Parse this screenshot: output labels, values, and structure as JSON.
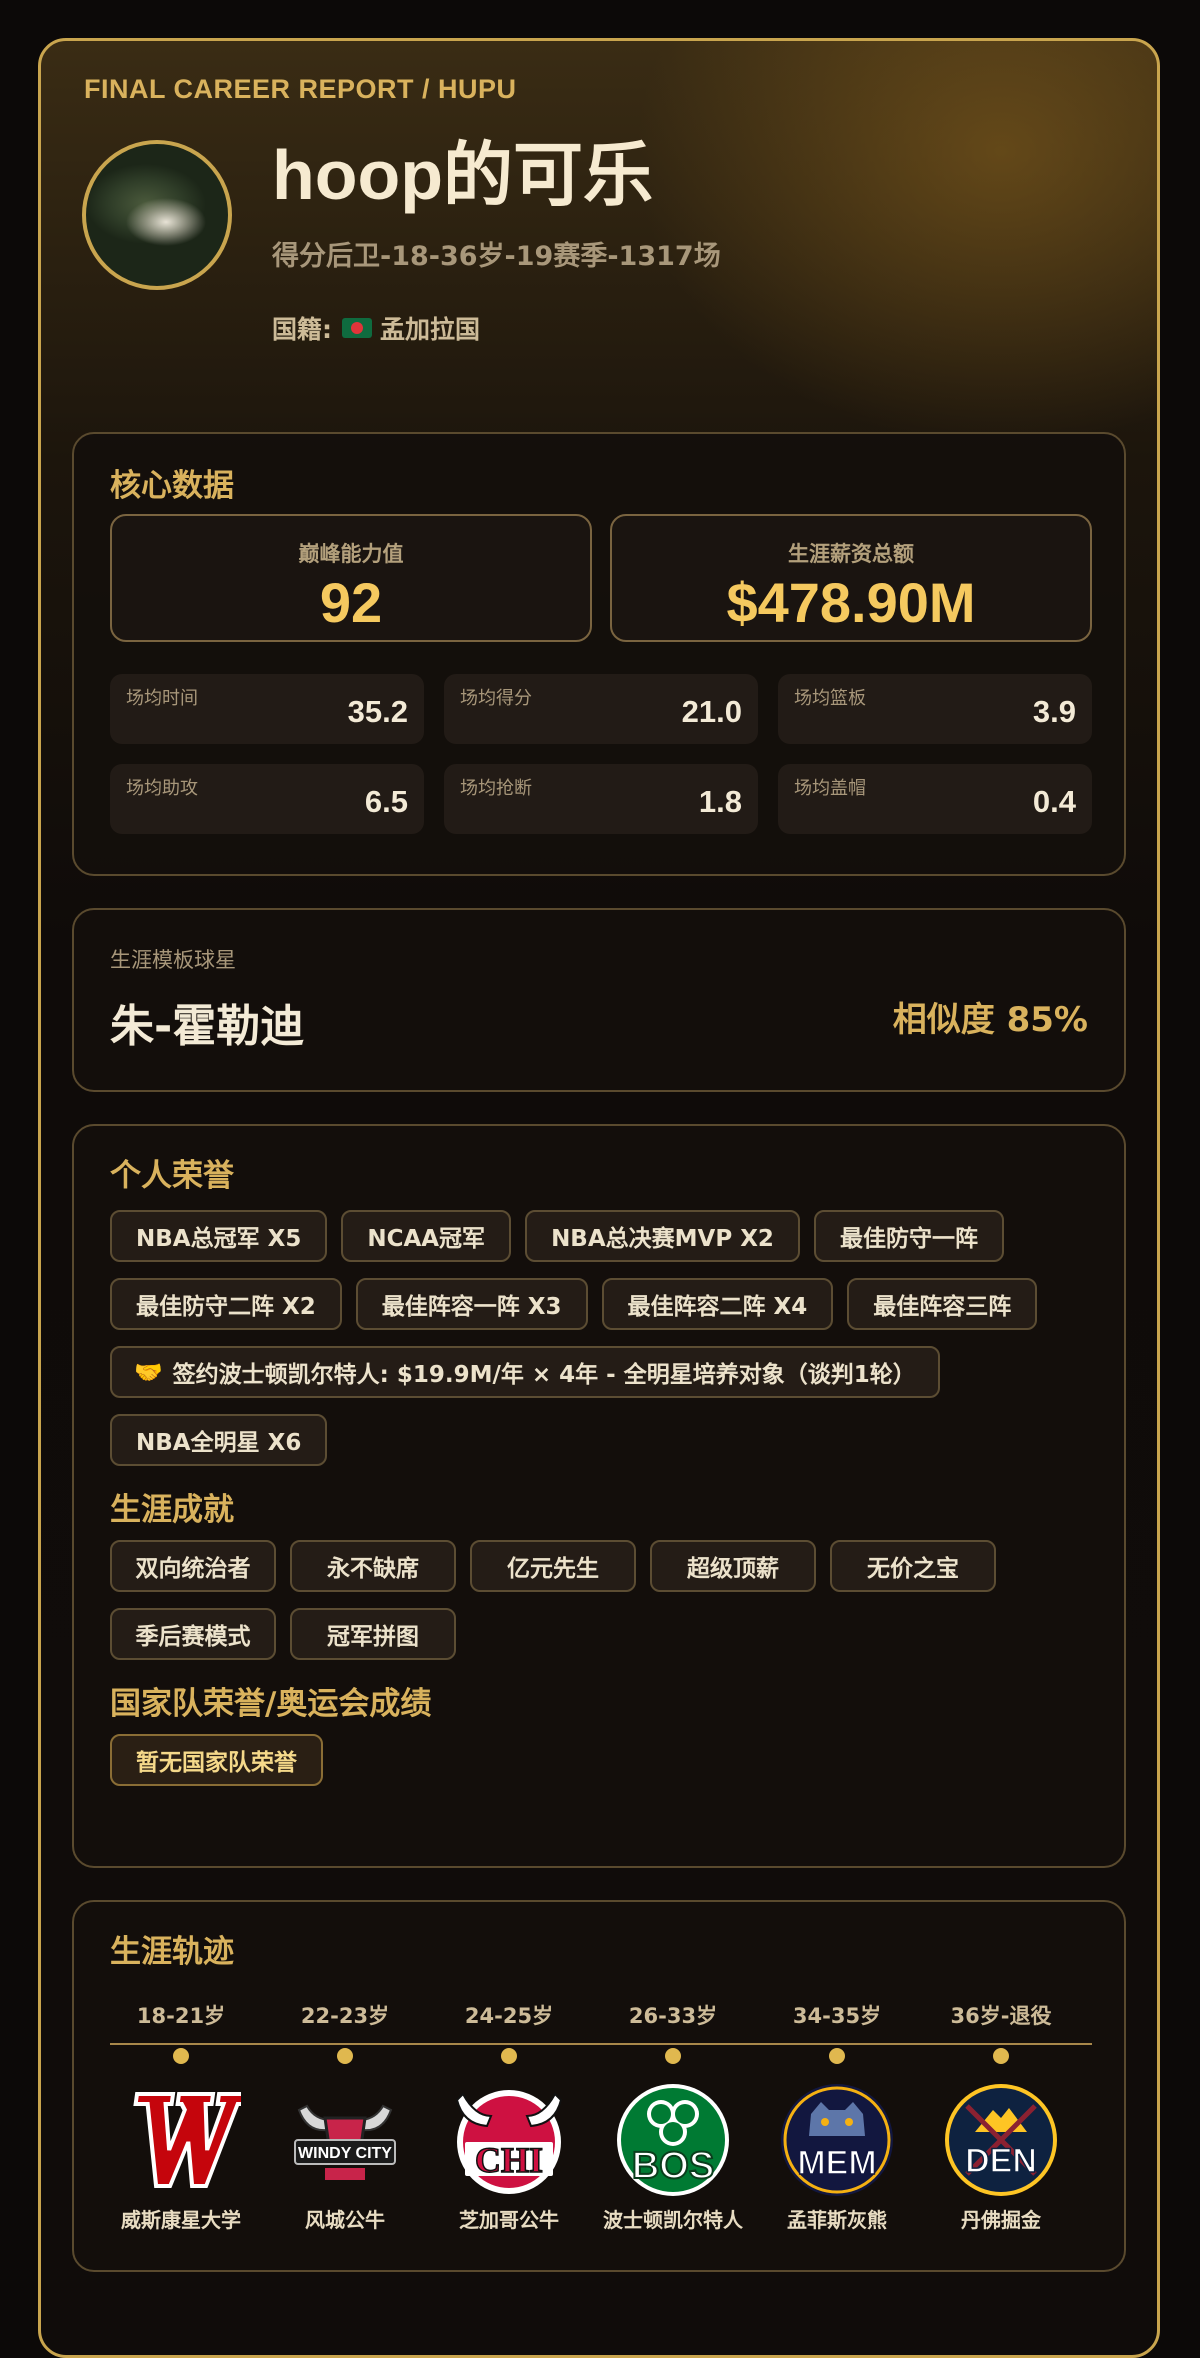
{
  "header": {
    "brand": "FINAL CAREER REPORT / HUPU",
    "player_name": "hoop的可乐",
    "subtitle": "得分后卫-18-36岁-19赛季-1317场",
    "nationality_label": "国籍:",
    "nationality": "孟加拉国"
  },
  "core": {
    "title": "核心数据",
    "peak_label": "巅峰能力值",
    "peak_value": "92",
    "salary_label": "生涯薪资总额",
    "salary_value": "$478.90M",
    "stats": [
      {
        "label": "场均时间",
        "value": "35.2"
      },
      {
        "label": "场均得分",
        "value": "21.0"
      },
      {
        "label": "场均篮板",
        "value": "3.9"
      },
      {
        "label": "场均助攻",
        "value": "6.5"
      },
      {
        "label": "场均抢断",
        "value": "1.8"
      },
      {
        "label": "场均盖帽",
        "value": "0.4"
      }
    ]
  },
  "template": {
    "label": "生涯模板球星",
    "name": "朱-霍勒迪",
    "similarity": "相似度 85%"
  },
  "honors": {
    "title": "个人荣誉",
    "row1": [
      "NBA总冠军 X5",
      "NCAA冠军",
      "NBA总决赛MVP X2",
      "最佳防守一阵"
    ],
    "row2": [
      "最佳防守二阵 X2",
      "最佳阵容一阵 X3",
      "最佳阵容二阵 X4",
      "最佳阵容三阵"
    ],
    "contract": "签约波士顿凯尔特人: $19.9M/年 × 4年 - 全明星培养对象（谈判1轮）",
    "row4": [
      "NBA全明星 X6"
    ],
    "achievements_title": "生涯成就",
    "achievements_row1": [
      "双向统治者",
      "永不缺席",
      "亿元先生",
      "超级顶薪",
      "无价之宝"
    ],
    "achievements_row2": [
      "季后赛模式",
      "冠军拼图"
    ],
    "national_title": "国家队荣誉/奥运会成绩",
    "national": "暂无国家队荣誉"
  },
  "timeline": {
    "title": "生涯轨迹",
    "stops": [
      {
        "age": "18-21岁",
        "team": "威斯康星大学",
        "logo": "wisconsin-w-logo",
        "text": ""
      },
      {
        "age": "22-23岁",
        "team": "风城公牛",
        "logo": "windy-city-bulls-logo",
        "text": "WINDY CITY"
      },
      {
        "age": "24-25岁",
        "team": "芝加哥公牛",
        "logo": "chicago-bulls-logo",
        "text": "CHI"
      },
      {
        "age": "26-33岁",
        "team": "波士顿凯尔特人",
        "logo": "boston-celtics-logo",
        "text": "BOS"
      },
      {
        "age": "34-35岁",
        "team": "孟菲斯灰熊",
        "logo": "memphis-grizzlies-logo",
        "text": "MEM"
      },
      {
        "age": "36岁-退役",
        "team": "丹佛掘金",
        "logo": "denver-nuggets-logo",
        "text": "DEN"
      }
    ]
  },
  "colors": {
    "accent": "#d9b25d",
    "border_gold": "#c9a54e",
    "value_gold": "#f5c95f"
  }
}
